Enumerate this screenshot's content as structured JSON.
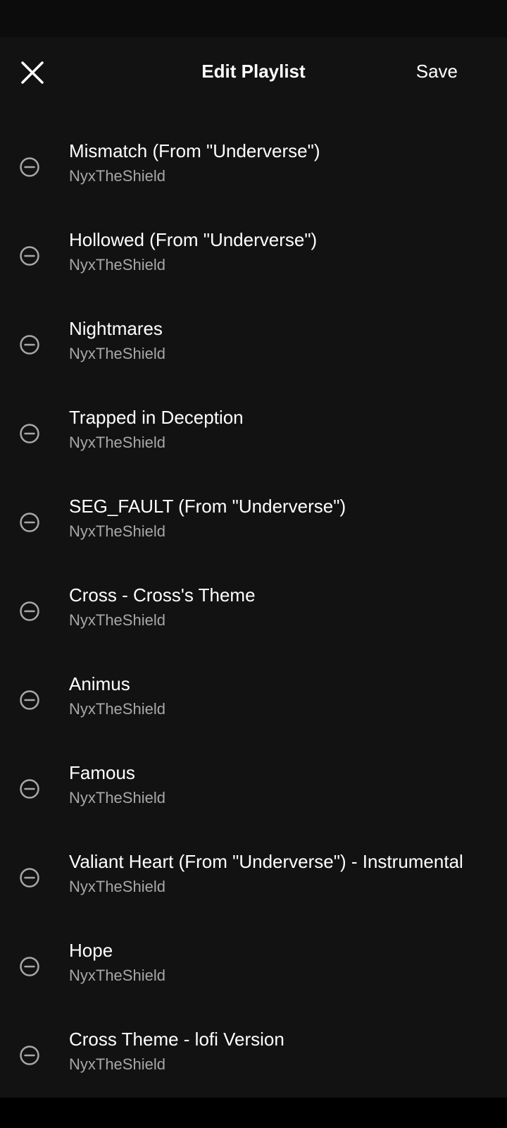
{
  "header": {
    "title": "Edit Playlist",
    "save_label": "Save",
    "close_icon": "close-icon"
  },
  "colors": {
    "background": "#121212",
    "primary_text": "#ffffff",
    "secondary_text": "#a7a7a7"
  },
  "tracks": [
    {
      "title": "Mismatch (From \"Underverse\")",
      "artist": "NyxTheShield"
    },
    {
      "title": "Hollowed (From \"Underverse\")",
      "artist": "NyxTheShield"
    },
    {
      "title": "Nightmares",
      "artist": "NyxTheShield"
    },
    {
      "title": "Trapped in Deception",
      "artist": "NyxTheShield"
    },
    {
      "title": "SEG_FAULT (From \"Underverse\")",
      "artist": "NyxTheShield"
    },
    {
      "title": "Cross - Cross's Theme",
      "artist": "NyxTheShield"
    },
    {
      "title": "Animus",
      "artist": "NyxTheShield"
    },
    {
      "title": "Famous",
      "artist": "NyxTheShield"
    },
    {
      "title": "Valiant Heart (From \"Underverse\") - Instrumental",
      "artist": "NyxTheShield"
    },
    {
      "title": "Hope",
      "artist": "NyxTheShield"
    },
    {
      "title": "Cross Theme - lofi Version",
      "artist": "NyxTheShield"
    }
  ]
}
